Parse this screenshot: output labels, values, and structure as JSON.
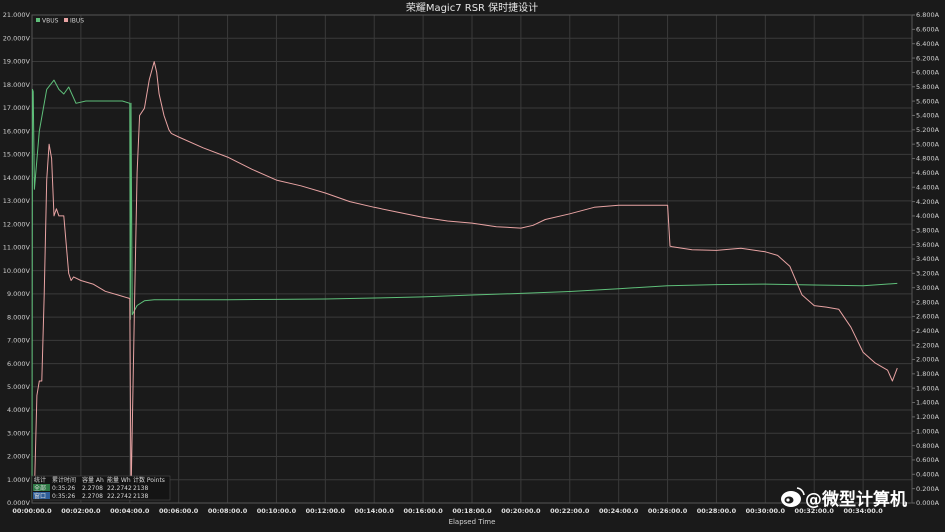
{
  "chart_data": {
    "type": "line",
    "title": "荣耀Magic7 RSR 保时捷设计",
    "xlabel": "Elapsed Time",
    "ylabel": "",
    "xlim_min": [
      0,
      36
    ],
    "ylim": [
      0,
      21
    ],
    "y2lim": [
      0,
      6.8
    ],
    "grid": true,
    "legend": {
      "placement": "top-left",
      "entries": [
        "VBUS",
        "IBUS"
      ]
    },
    "colors": {
      "vbus": "#5fbf7a",
      "ibus": "#e8a3a3",
      "background": "#1a1a1a",
      "grid": "#3a3a3a"
    },
    "x_ticks": [
      "00:00:00.0",
      "00:02:00.0",
      "00:04:00.0",
      "00:06:00.0",
      "00:08:00.0",
      "00:10:00.0",
      "00:12:00.0",
      "00:14:00.0",
      "00:16:00.0",
      "00:18:00.0",
      "00:20:00.0",
      "00:22:00.0",
      "00:24:00.0",
      "00:26:00.0",
      "00:28:00.0",
      "00:30:00.0",
      "00:32:00.0",
      "00:34:00.0"
    ],
    "y_ticks": [
      "0.000V",
      "1.000V",
      "2.000V",
      "3.000V",
      "4.000V",
      "5.000V",
      "6.000V",
      "7.000V",
      "8.000V",
      "9.000V",
      "10.000V",
      "11.000V",
      "12.000V",
      "13.000V",
      "14.000V",
      "15.000V",
      "16.000V",
      "17.000V",
      "18.000V",
      "19.000V",
      "20.000V",
      "21.000V"
    ],
    "y2_ticks": [
      "0.000A",
      "0.200A",
      "0.400A",
      "0.600A",
      "0.800A",
      "1.000A",
      "1.200A",
      "1.400A",
      "1.600A",
      "1.800A",
      "2.000A",
      "2.200A",
      "2.400A",
      "2.600A",
      "2.800A",
      "3.000A",
      "3.200A",
      "3.400A",
      "3.600A",
      "3.800A",
      "4.000A",
      "4.200A",
      "4.400A",
      "4.600A",
      "4.800A",
      "5.000A",
      "5.200A",
      "5.400A",
      "5.600A",
      "5.800A",
      "6.000A",
      "6.200A",
      "6.400A",
      "6.600A",
      "6.800A"
    ],
    "series": [
      {
        "name": "VBUS",
        "axis": "left",
        "x": [
          0,
          0.02,
          0.05,
          0.1,
          0.3,
          0.6,
          0.9,
          1.1,
          1.3,
          1.5,
          1.8,
          2.2,
          3.0,
          3.7,
          4.0,
          4.02,
          4.05,
          4.1,
          4.3,
          4.6,
          5.0,
          6.0,
          8.0,
          10.0,
          12.0,
          14.0,
          16.0,
          18.0,
          20.0,
          22.0,
          24.0,
          26.0,
          28.0,
          30.0,
          32.0,
          34.0,
          35.4
        ],
        "values": [
          0.2,
          17.8,
          17.7,
          13.5,
          16.0,
          17.8,
          18.2,
          17.8,
          17.6,
          17.9,
          17.2,
          17.3,
          17.3,
          17.3,
          17.2,
          7.9,
          17.2,
          8.1,
          8.5,
          8.7,
          8.75,
          8.75,
          8.75,
          8.76,
          8.78,
          8.82,
          8.87,
          8.95,
          9.02,
          9.1,
          9.22,
          9.35,
          9.4,
          9.42,
          9.38,
          9.35,
          9.45
        ]
      },
      {
        "name": "IBUS",
        "axis": "right",
        "x": [
          0,
          0.1,
          0.2,
          0.3,
          0.4,
          0.5,
          0.6,
          0.7,
          0.8,
          0.9,
          1.0,
          1.1,
          1.3,
          1.5,
          1.6,
          1.7,
          2.0,
          2.5,
          3.0,
          3.5,
          4.0,
          4.05,
          4.1,
          4.2,
          4.3,
          4.4,
          4.6,
          4.8,
          5.0,
          5.1,
          5.2,
          5.4,
          5.6,
          5.7,
          6.0,
          7.0,
          8.0,
          9.0,
          10.0,
          11.0,
          12.0,
          13.0,
          14.0,
          15.0,
          16.0,
          17.0,
          18.0,
          19.0,
          20.0,
          20.5,
          21.0,
          22.0,
          23.0,
          24.0,
          25.0,
          26.0,
          26.1,
          26.2,
          27.0,
          28.0,
          29.0,
          30.0,
          30.5,
          31.0,
          31.5,
          32.0,
          32.5,
          33.0,
          33.5,
          34.0,
          34.5,
          35.0,
          35.2,
          35.4
        ],
        "values": [
          0.05,
          0.15,
          1.5,
          1.7,
          1.7,
          2.9,
          4.5,
          5.0,
          4.8,
          4.0,
          4.1,
          4.0,
          4.0,
          3.2,
          3.1,
          3.15,
          3.1,
          3.05,
          2.95,
          2.9,
          2.85,
          0.1,
          1.0,
          2.9,
          4.6,
          5.4,
          5.5,
          5.9,
          6.15,
          6.0,
          5.7,
          5.4,
          5.2,
          5.15,
          5.1,
          4.95,
          4.82,
          4.65,
          4.5,
          4.42,
          4.32,
          4.2,
          4.12,
          4.05,
          3.98,
          3.93,
          3.9,
          3.85,
          3.83,
          3.87,
          3.95,
          4.03,
          4.12,
          4.15,
          4.15,
          4.15,
          3.58,
          3.57,
          3.53,
          3.52,
          3.55,
          3.5,
          3.45,
          3.3,
          2.9,
          2.75,
          2.73,
          2.7,
          2.45,
          2.1,
          1.95,
          1.85,
          1.7,
          1.88
        ]
      }
    ],
    "stats_table": {
      "header": [
        "统计",
        "累计时间",
        "容量 Ah",
        "能量 Wh",
        "计数 Points"
      ],
      "rows": [
        [
          "全部",
          "0:35:26",
          "2.2708",
          "22.2742",
          "2138"
        ],
        [
          "窗口",
          "0:35:26",
          "2.2708",
          "22.2742",
          "2138"
        ]
      ]
    }
  },
  "watermark": {
    "icon": "weibo-icon",
    "text": "@微型计算机"
  }
}
